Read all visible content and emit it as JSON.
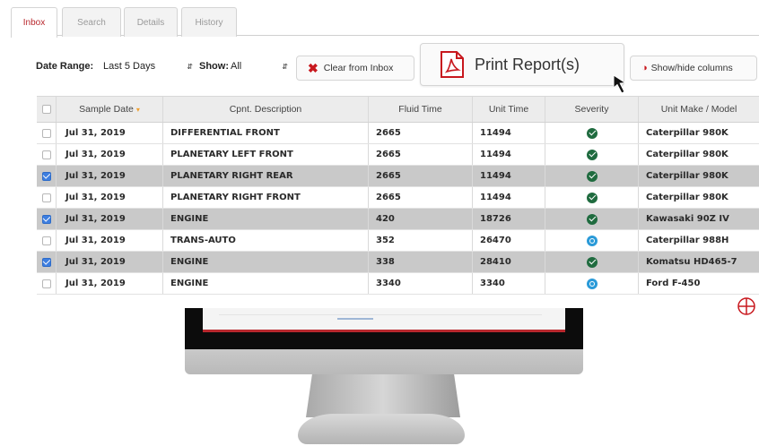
{
  "tabs": [
    {
      "label": "Inbox",
      "active": true
    },
    {
      "label": "Search",
      "active": false
    },
    {
      "label": "Details",
      "active": false
    },
    {
      "label": "History",
      "active": false
    }
  ],
  "toolbar": {
    "date_range_label": "Date Range:",
    "date_range_value": "Last 5 Days",
    "show_label": "Show:",
    "show_value": "All",
    "clear_label": "Clear from Inbox",
    "print_label": "Print Report(s)",
    "columns_label": "Show/hide columns"
  },
  "table": {
    "headers": {
      "date": "Sample Date",
      "desc": "Cpnt. Description",
      "fluid": "Fluid Time",
      "unit": "Unit Time",
      "severity": "Severity",
      "make": "Unit Make / Model"
    },
    "rows": [
      {
        "checked": false,
        "date": "Jul 31, 2019",
        "desc": "DIFFERENTIAL FRONT",
        "fluid": "2665",
        "unit": "11494",
        "severity": "ok",
        "make": "Caterpillar 980K"
      },
      {
        "checked": false,
        "date": "Jul 31, 2019",
        "desc": "PLANETARY LEFT FRONT",
        "fluid": "2665",
        "unit": "11494",
        "severity": "ok",
        "make": "Caterpillar 980K"
      },
      {
        "checked": true,
        "date": "Jul 31, 2019",
        "desc": "PLANETARY RIGHT REAR",
        "fluid": "2665",
        "unit": "11494",
        "severity": "ok",
        "make": "Caterpillar 980K"
      },
      {
        "checked": false,
        "date": "Jul 31, 2019",
        "desc": "PLANETARY RIGHT FRONT",
        "fluid": "2665",
        "unit": "11494",
        "severity": "ok",
        "make": "Caterpillar 980K"
      },
      {
        "checked": true,
        "date": "Jul 31, 2019",
        "desc": "ENGINE",
        "fluid": "420",
        "unit": "18726",
        "severity": "ok",
        "make": "Kawasaki 90Z IV"
      },
      {
        "checked": false,
        "date": "Jul 31, 2019",
        "desc": "TRANS-AUTO",
        "fluid": "352",
        "unit": "26470",
        "severity": "info",
        "make": "Caterpillar 988H"
      },
      {
        "checked": true,
        "date": "Jul 31, 2019",
        "desc": "ENGINE",
        "fluid": "338",
        "unit": "28410",
        "severity": "ok",
        "make": "Komatsu HD465-7"
      },
      {
        "checked": false,
        "date": "Jul 31, 2019",
        "desc": "ENGINE",
        "fluid": "3340",
        "unit": "3340",
        "severity": "info",
        "make": "Ford F-450"
      }
    ]
  },
  "colors": {
    "accent_red": "#c8181e",
    "selected_row": "#c9c9c9",
    "severity_ok": "#1f6b3f",
    "severity_info": "#2a9ad8",
    "checkbox_on": "#3d7ee0"
  },
  "icons": {
    "clear": "x-icon",
    "print": "pdf-icon",
    "columns": "half-circle-icon",
    "sort": "sort-desc-icon",
    "severity_ok": "check-circle-icon",
    "severity_info": "search-circle-icon",
    "cursor": "mouse-pointer-icon",
    "zoom": "crosshair-circle-icon"
  }
}
